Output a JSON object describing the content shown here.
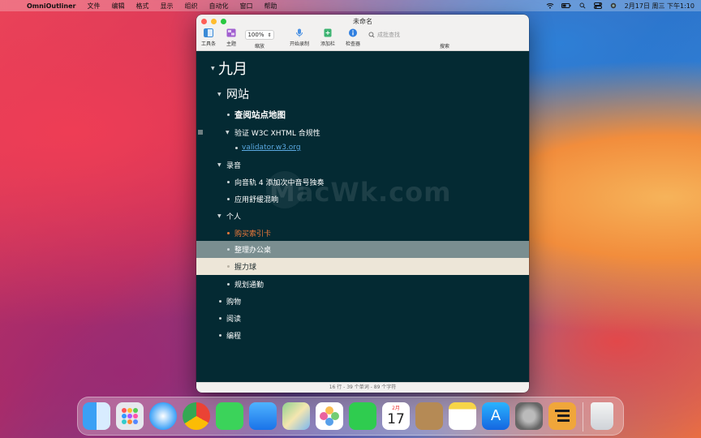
{
  "menubar": {
    "app_name": "OmniOutliner",
    "items": [
      "文件",
      "编辑",
      "格式",
      "显示",
      "组织",
      "自动化",
      "窗口",
      "帮助"
    ],
    "clock": "2月17日 周三 下午1:10"
  },
  "window": {
    "title": "未命名",
    "toolbar": {
      "toolbar_label": "工具条",
      "theme_label": "主题",
      "zoom_value": "100%",
      "zoom_label": "缩放",
      "record_label": "开始录制",
      "add_column_label": "添加栏",
      "inspector_label": "检查器",
      "search_placeholder": "成批查找",
      "search_label": "搜索"
    },
    "status": "16 行 - 39 个单词 - 89 个字符"
  },
  "outline": {
    "rows": [
      {
        "text": "九月"
      },
      {
        "text": "网站"
      },
      {
        "text": "查阅站点地图"
      },
      {
        "text": "验证 W3C XHTML 合规性"
      },
      {
        "text": "validator.w3.org"
      },
      {
        "text": "录音"
      },
      {
        "text": "向音轨 4 添加次中音号独奏"
      },
      {
        "text": "应用舒缓混响"
      },
      {
        "text": "个人"
      },
      {
        "text": "购买索引卡"
      },
      {
        "text": "整理办公桌"
      },
      {
        "text": "握力球"
      },
      {
        "text": "规划通勤"
      },
      {
        "text": "购物"
      },
      {
        "text": "阅读"
      },
      {
        "text": "编程"
      }
    ]
  },
  "watermark": "MacWk.com",
  "dock": {
    "calendar_month": "2月",
    "calendar_day": "17"
  },
  "colors": {
    "outline_bg": "#042a33",
    "selected_grey": "#7a8e90",
    "selected_cream": "#ede6d8",
    "link": "#5aa8e0",
    "accent_orange": "#f07a3a"
  }
}
